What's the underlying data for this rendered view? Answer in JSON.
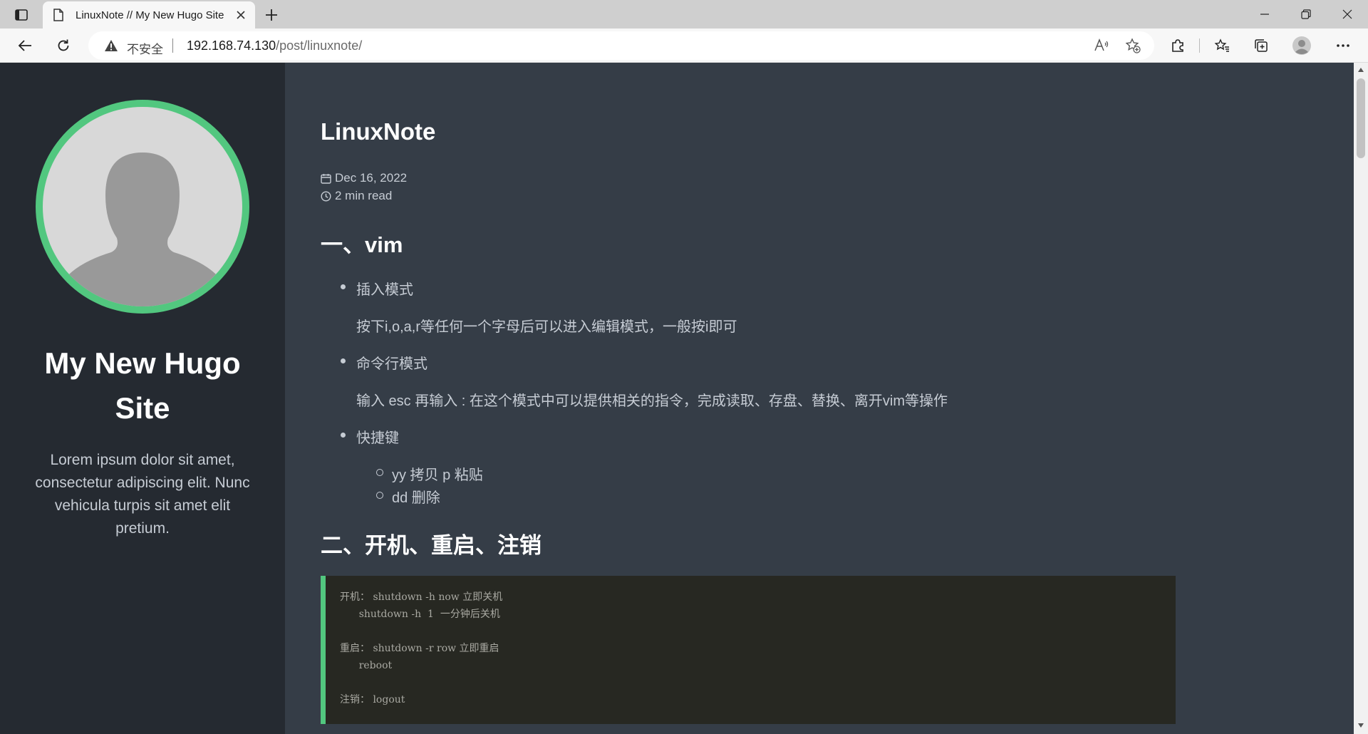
{
  "browser": {
    "tab_title": "LinuxNote // My New Hugo Site",
    "insecure_label": "不安全",
    "url_host": "192.168.74.130",
    "url_path": "/post/linuxnote/"
  },
  "sidebar": {
    "site_title": "My New Hugo Site",
    "description": "Lorem ipsum dolor sit amet, consectetur adipiscing elit. Nunc vehicula turpis sit amet elit pretium."
  },
  "post": {
    "title": "LinuxNote",
    "date": "Dec 16, 2022",
    "read_time": "2 min read",
    "section1": {
      "heading": "一、vim",
      "items": [
        {
          "label": "插入模式",
          "desc": "按下i,o,a,r等任何一个字母后可以进入编辑模式，一般按i即可"
        },
        {
          "label": "命令行模式",
          "desc": "输入 esc 再输入 : 在这个模式中可以提供相关的指令，完成读取、存盘、替换、离开vim等操作"
        },
        {
          "label": "快捷键",
          "subitems": [
            "yy 拷贝 p 粘贴",
            "dd 删除"
          ]
        }
      ]
    },
    "section2": {
      "heading": "二、开机、重启、注销",
      "code": "开机： shutdown -h now 立即关机\n      shutdown -h  1  一分钟后关机\n\n重启： shutdown -r row 立即重启\n      reboot\n\n注销： logout"
    }
  },
  "colors": {
    "accent": "#52c77f",
    "sidebar_bg": "#252a31",
    "main_bg": "#353d47",
    "code_bg": "#272822"
  }
}
